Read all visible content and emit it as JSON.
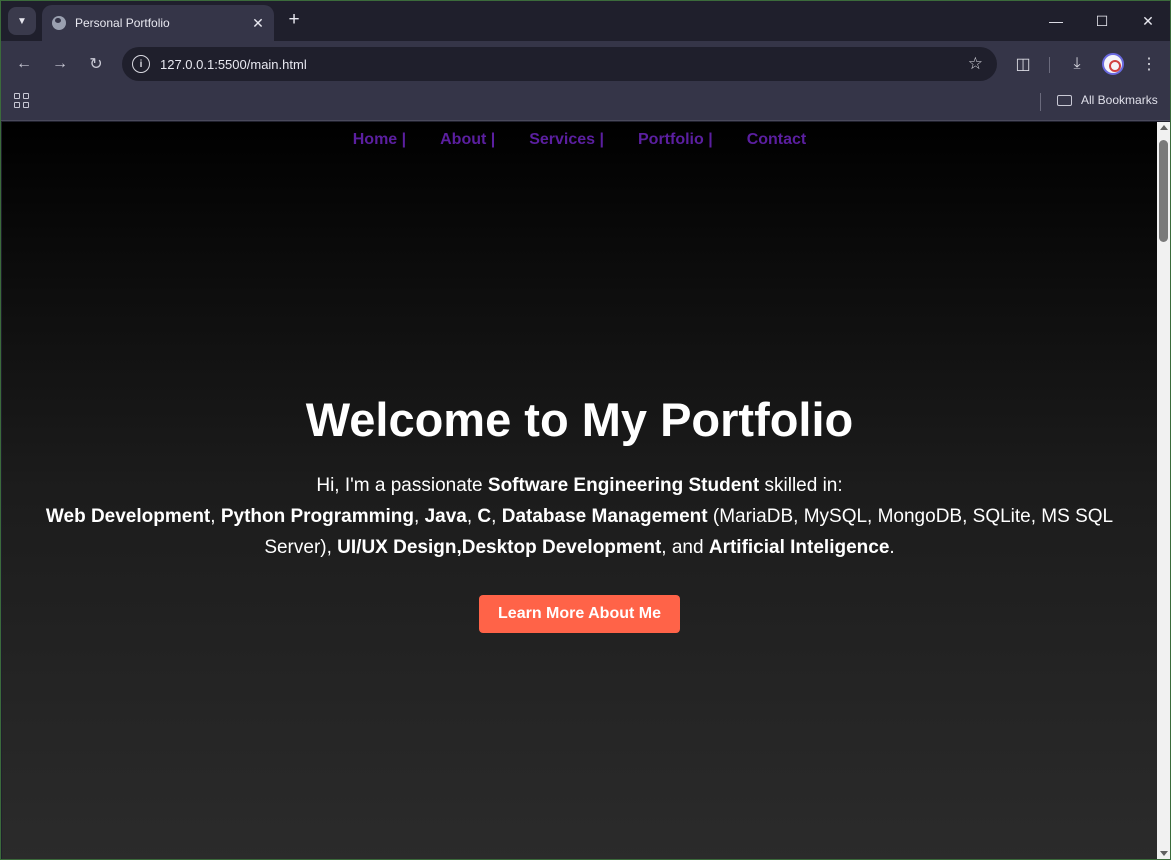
{
  "browser": {
    "tab_title": "Personal Portfolio",
    "url": "127.0.0.1:5500/main.html",
    "bookmarks_label": "All Bookmarks"
  },
  "nav": {
    "items": [
      {
        "label": "Home |"
      },
      {
        "label": "About |"
      },
      {
        "label": "Services |"
      },
      {
        "label": "Portfolio |"
      },
      {
        "label": "Contact"
      }
    ],
    "color": "#5b1fa0"
  },
  "hero": {
    "title": "Welcome to My Portfolio",
    "intro_prefix": "Hi, I'm a passionate ",
    "intro_role": "Software Engineering Student",
    "intro_suffix": " skilled in:",
    "skills": {
      "web": "Web Development",
      "sep1": ", ",
      "python": "Python Programming",
      "sep2": ", ",
      "java": "Java",
      "sep3": ", ",
      "c": "C",
      "sep4": ", ",
      "db": "Database Management",
      "db_list": " (MariaDB, MySQL, MongoDB, SQLite, MS SQL Server), ",
      "uiux": "UI/UX Design,Desktop Development",
      "sep5": ", and ",
      "ai": "Artificial Inteligence",
      "end": "."
    },
    "button_label": "Learn More About Me",
    "button_color": "#ff6348"
  }
}
